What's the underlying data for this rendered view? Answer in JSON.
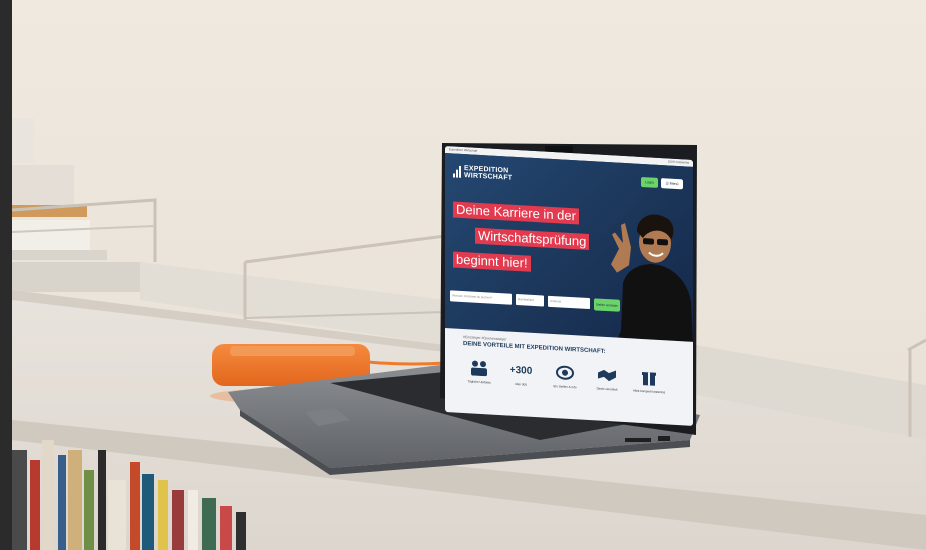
{
  "browser": {
    "left_text": "Expedition Wirtschaft",
    "right_text": "100% kostenlos"
  },
  "site": {
    "logo_line1": "EXPEDITION",
    "logo_line2": "WIRTSCHAFT",
    "login_label": "Login",
    "menu_label": "☰ Menü"
  },
  "hero": {
    "headline_line1": "Deine Karriere in der",
    "headline_line2": "Wirtschaftsprüfung",
    "headline_line3": "beginnt hier!",
    "search_placeholder": "Wonach möchtest du suchen?",
    "field2_placeholder": "Bundesland",
    "field3_placeholder": "Umkreis",
    "search_button": "Stellen anzeigen"
  },
  "benefits": {
    "kicker": "#Einsteiger #Quereinsteiger",
    "title": "DEINE VORTEILE MIT EXPEDITION WIRTSCHAFT:",
    "items": [
      {
        "icon": "team-icon",
        "glyph": "",
        "caption": "Tägliche Updates"
      },
      {
        "icon": "count-icon",
        "glyph": "+300",
        "caption": "über 300"
      },
      {
        "icon": "eye-icon",
        "glyph": "",
        "caption": "Ein Stellen & Info"
      },
      {
        "icon": "handshake-icon",
        "glyph": "",
        "caption": "Direkt vermittelt"
      },
      {
        "icon": "gift-icon",
        "glyph": "",
        "caption": "Alles komplett kostenlos"
      }
    ]
  },
  "colors": {
    "hero_blue": "#1d3a5c",
    "headline_red": "#e23a4f",
    "button_green": "#6cd36a",
    "drive_orange": "#f07a2c"
  }
}
